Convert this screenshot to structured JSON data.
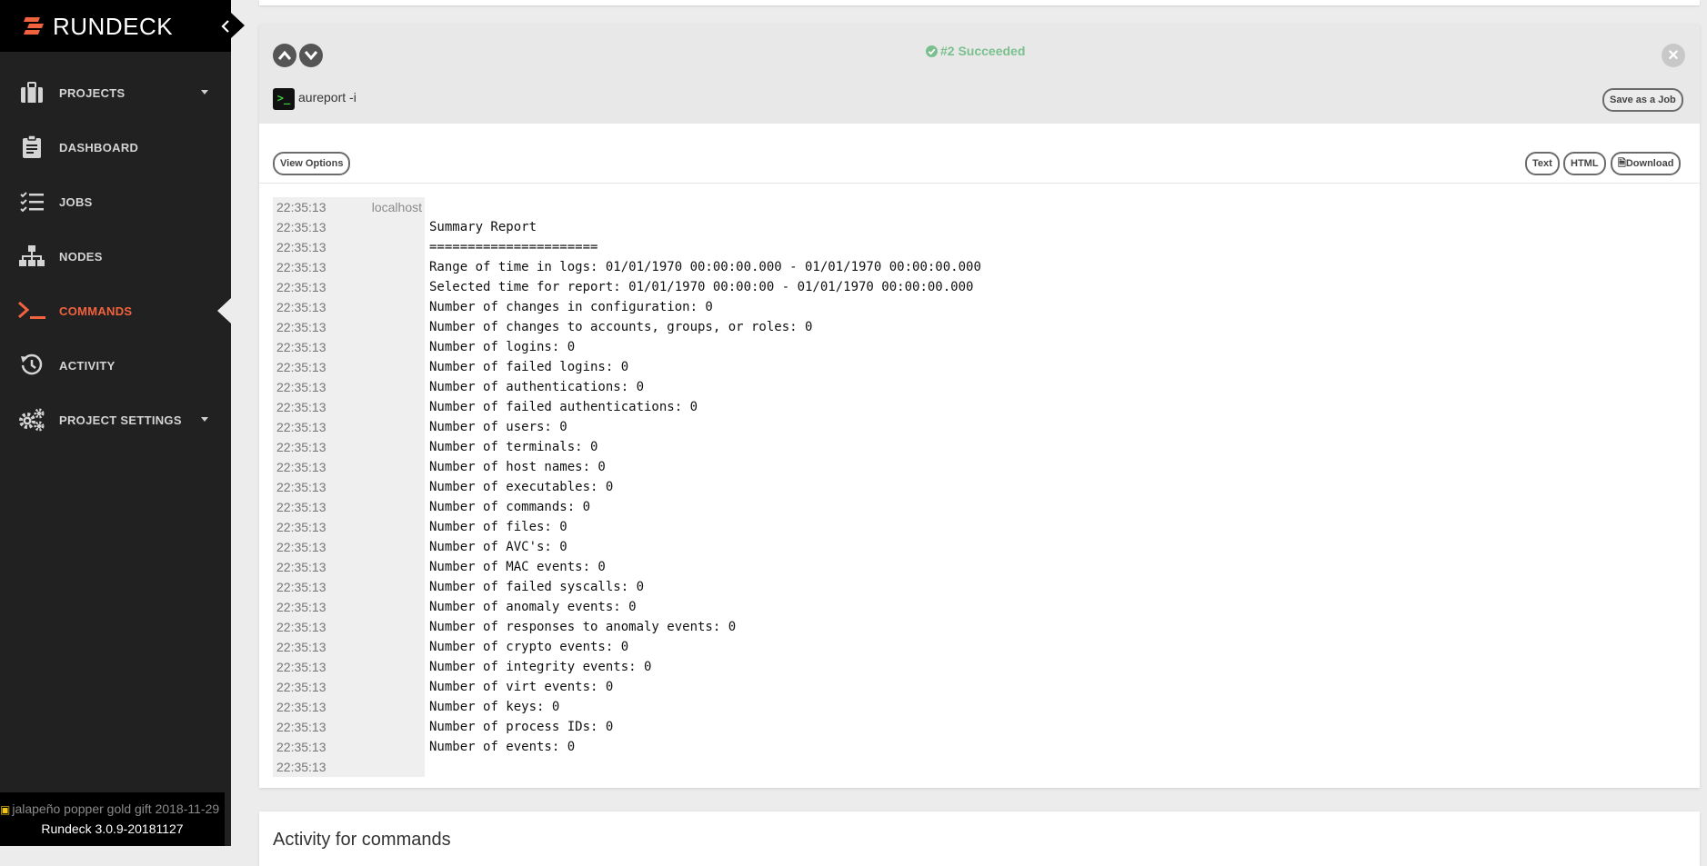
{
  "app": {
    "brand": "RUNDECK",
    "accent_color": "#f1623f",
    "success_color": "#7ac08e"
  },
  "sidebar": {
    "items": [
      {
        "label": "PROJECTS",
        "icon": "briefcase-icon",
        "has_dropdown": true
      },
      {
        "label": "DASHBOARD",
        "icon": "clipboard-icon"
      },
      {
        "label": "JOBS",
        "icon": "task-list-icon"
      },
      {
        "label": "NODES",
        "icon": "sitemap-icon"
      },
      {
        "label": "COMMANDS",
        "icon": "terminal-prompt-icon",
        "active": true
      },
      {
        "label": "ACTIVITY",
        "icon": "history-icon"
      },
      {
        "label": "PROJECT SETTINGS",
        "icon": "gears-icon",
        "has_dropdown": true
      }
    ],
    "footer": {
      "gift_text": "jalapeño popper gold gift 2018-11-29",
      "version": "Rundeck 3.0.9-20181127"
    }
  },
  "execution": {
    "status": "#2 Succeeded",
    "command": "aureport -i",
    "save_job_label": "Save as a Job",
    "view_options_label": "View Options",
    "text_label": "Text",
    "html_label": "HTML",
    "download_label": "Download",
    "log": [
      {
        "time": "22:35:13",
        "node": "localhost",
        "text": ""
      },
      {
        "time": "22:35:13",
        "node": "",
        "text": "Summary Report"
      },
      {
        "time": "22:35:13",
        "node": "",
        "text": "======================"
      },
      {
        "time": "22:35:13",
        "node": "",
        "text": "Range of time in logs: 01/01/1970 00:00:00.000 - 01/01/1970 00:00:00.000"
      },
      {
        "time": "22:35:13",
        "node": "",
        "text": "Selected time for report: 01/01/1970 00:00:00 - 01/01/1970 00:00:00.000"
      },
      {
        "time": "22:35:13",
        "node": "",
        "text": "Number of changes in configuration: 0"
      },
      {
        "time": "22:35:13",
        "node": "",
        "text": "Number of changes to accounts, groups, or roles: 0"
      },
      {
        "time": "22:35:13",
        "node": "",
        "text": "Number of logins: 0"
      },
      {
        "time": "22:35:13",
        "node": "",
        "text": "Number of failed logins: 0"
      },
      {
        "time": "22:35:13",
        "node": "",
        "text": "Number of authentications: 0"
      },
      {
        "time": "22:35:13",
        "node": "",
        "text": "Number of failed authentications: 0"
      },
      {
        "time": "22:35:13",
        "node": "",
        "text": "Number of users: 0"
      },
      {
        "time": "22:35:13",
        "node": "",
        "text": "Number of terminals: 0"
      },
      {
        "time": "22:35:13",
        "node": "",
        "text": "Number of host names: 0"
      },
      {
        "time": "22:35:13",
        "node": "",
        "text": "Number of executables: 0"
      },
      {
        "time": "22:35:13",
        "node": "",
        "text": "Number of commands: 0"
      },
      {
        "time": "22:35:13",
        "node": "",
        "text": "Number of files: 0"
      },
      {
        "time": "22:35:13",
        "node": "",
        "text": "Number of AVC's: 0"
      },
      {
        "time": "22:35:13",
        "node": "",
        "text": "Number of MAC events: 0"
      },
      {
        "time": "22:35:13",
        "node": "",
        "text": "Number of failed syscalls: 0"
      },
      {
        "time": "22:35:13",
        "node": "",
        "text": "Number of anomaly events: 0"
      },
      {
        "time": "22:35:13",
        "node": "",
        "text": "Number of responses to anomaly events: 0"
      },
      {
        "time": "22:35:13",
        "node": "",
        "text": "Number of crypto events: 0"
      },
      {
        "time": "22:35:13",
        "node": "",
        "text": "Number of integrity events: 0"
      },
      {
        "time": "22:35:13",
        "node": "",
        "text": "Number of virt events: 0"
      },
      {
        "time": "22:35:13",
        "node": "",
        "text": "Number of keys: 0"
      },
      {
        "time": "22:35:13",
        "node": "",
        "text": "Number of process IDs: 0"
      },
      {
        "time": "22:35:13",
        "node": "",
        "text": "Number of events: 0"
      },
      {
        "time": "22:35:13",
        "node": "",
        "text": ""
      }
    ]
  },
  "activity": {
    "title": "Activity for commands"
  }
}
